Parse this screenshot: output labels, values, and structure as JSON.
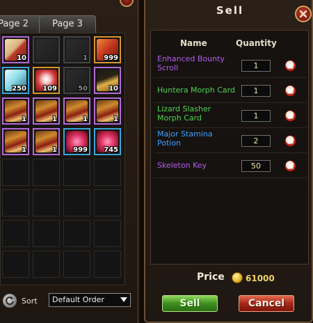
{
  "inventory": {
    "tabs": [
      {
        "label": "Page 2"
      },
      {
        "label": "Page 3"
      }
    ],
    "slots": [
      {
        "row": 0,
        "col": 0,
        "qty": "10",
        "icon": "exp-scroll-icon",
        "frame": "purple"
      },
      {
        "row": 0,
        "col": 1,
        "qty": "",
        "icon": "faded-item-icon",
        "frame": "gray"
      },
      {
        "row": 0,
        "col": 2,
        "qty": "1",
        "icon": "faded-item-icon",
        "frame": "gray"
      },
      {
        "row": 0,
        "col": 3,
        "qty": "999",
        "icon": "red-book-icon",
        "frame": "orange"
      },
      {
        "row": 1,
        "col": 0,
        "qty": "250",
        "icon": "crystal-icon",
        "frame": "blue"
      },
      {
        "row": 1,
        "col": 1,
        "qty": "109",
        "icon": "mystery-box-icon",
        "frame": "orange"
      },
      {
        "row": 1,
        "col": 2,
        "qty": "50",
        "icon": "faded-item-icon",
        "frame": "gray"
      },
      {
        "row": 1,
        "col": 3,
        "qty": "10",
        "icon": "golden-horn-icon",
        "frame": "purple"
      },
      {
        "row": 2,
        "col": 0,
        "qty": "1",
        "icon": "warrior-card-icon",
        "frame": "purple"
      },
      {
        "row": 2,
        "col": 1,
        "qty": "1",
        "icon": "warrior-card-icon",
        "frame": "purple"
      },
      {
        "row": 2,
        "col": 2,
        "qty": "1",
        "icon": "warrior-card-icon",
        "frame": "purple"
      },
      {
        "row": 2,
        "col": 3,
        "qty": "1",
        "icon": "warrior-card-icon",
        "frame": "purple"
      },
      {
        "row": 3,
        "col": 0,
        "qty": "1",
        "icon": "warrior-card-icon",
        "frame": "purple"
      },
      {
        "row": 3,
        "col": 1,
        "qty": "1",
        "icon": "warrior-card-icon",
        "frame": "purple"
      },
      {
        "row": 3,
        "col": 2,
        "qty": "999",
        "icon": "red-flower-icon",
        "frame": "blue"
      },
      {
        "row": 3,
        "col": 3,
        "qty": "745",
        "icon": "red-flower-icon",
        "frame": "blue"
      }
    ],
    "sort_label": "Sort",
    "order_select_value": "Default Order"
  },
  "sell": {
    "title": "Sell",
    "header_name": "Name",
    "header_quantity": "Quantity",
    "items": [
      {
        "name": "Enhanced Bounty Scroll",
        "quantity": "1",
        "color": "#b35ee8"
      },
      {
        "name": "Huntera Morph Card",
        "quantity": "1",
        "color": "#4fd24f"
      },
      {
        "name": "Lizard Slasher Morph Card",
        "quantity": "1",
        "color": "#4fd24f"
      },
      {
        "name": "Major Stamina Potion",
        "quantity": "2",
        "color": "#3ba3ff"
      },
      {
        "name": "Skeleton Key",
        "quantity": "50",
        "color": "#b35ee8"
      }
    ],
    "price_label": "Price",
    "price_value": "61000",
    "sell_button": "Sell",
    "cancel_button": "Cancel"
  }
}
